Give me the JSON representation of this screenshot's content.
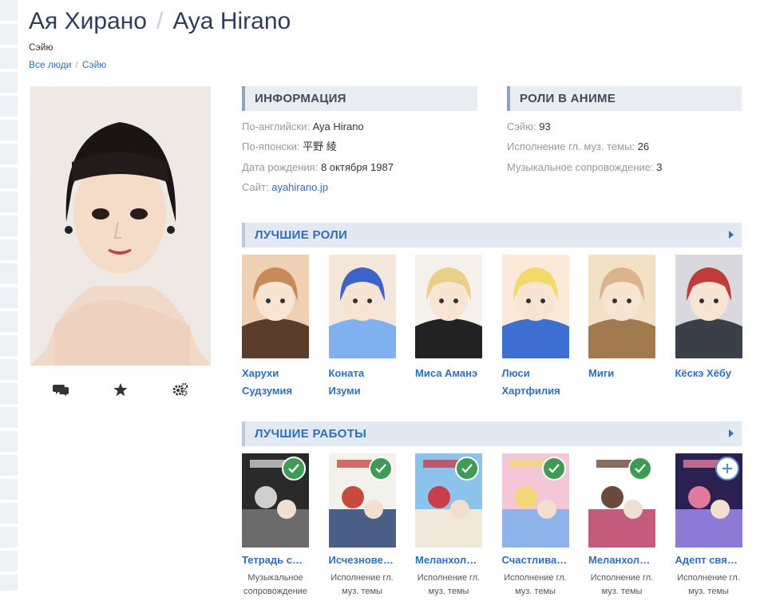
{
  "header": {
    "name_ru": "Ая Хирано",
    "separator": "/",
    "name_en": "Aya Hirano",
    "role": "Сэйю"
  },
  "breadcrumb": {
    "root": "Все люди",
    "sep": "/",
    "current": "Сэйю"
  },
  "actions": {
    "icons": [
      "comments-icon",
      "star-icon",
      "cogs-icon"
    ]
  },
  "info": {
    "title": "Информация",
    "rows": [
      {
        "label": "По-английски:",
        "value": "Aya Hirano"
      },
      {
        "label": "По-японски:",
        "value": "平野 綾"
      },
      {
        "label": "Дата рождения:",
        "value": "8 октября 1987"
      },
      {
        "label": "Сайт:",
        "value": "ayahirano.jp"
      }
    ]
  },
  "roles": {
    "title": "Роли в аниме",
    "rows": [
      {
        "label": "Сэйю:",
        "value": "93"
      },
      {
        "label": "Исполнение гл. муз. темы:",
        "value": "26"
      },
      {
        "label": "Музыкальное сопровождение:",
        "value": "3"
      }
    ]
  },
  "best_roles": {
    "title": "Лучшие роли",
    "items": [
      {
        "name": "Харухи Судзумия",
        "colors": [
          "#c98a5a",
          "#5a3d2b",
          "#f0d0b4"
        ]
      },
      {
        "name": "Коната Изуми",
        "colors": [
          "#3c64c8",
          "#7fb0f0",
          "#f5e6da"
        ]
      },
      {
        "name": "Миса Аманэ",
        "colors": [
          "#e8cf86",
          "#222222",
          "#f5f0ea"
        ]
      },
      {
        "name": "Люси Хартфилия",
        "colors": [
          "#f2d96a",
          "#3d6fd1",
          "#fbe9d7"
        ]
      },
      {
        "name": "Миги",
        "colors": [
          "#d9b48f",
          "#a27a4f",
          "#f3e1c6"
        ]
      },
      {
        "name": "Кёскэ Хёбу",
        "colors": [
          "#c23b3b",
          "#3a3f4a",
          "#d8d8de"
        ]
      }
    ]
  },
  "best_works": {
    "title": "Лучшие работы",
    "items": [
      {
        "name": "Тетрадь смерти",
        "role": "Музыкальное сопровождение",
        "status": "ok",
        "colors": [
          "#2a2a2a",
          "#6b6b6b",
          "#cfcfcf"
        ]
      },
      {
        "name": "Исчезновение Харухи Судзумии",
        "role": "Исполнение гл. муз. темы",
        "status": "ok",
        "colors": [
          "#f3f1ec",
          "#4b5e86",
          "#c94a3d"
        ]
      },
      {
        "name": "Меланхолия Харухи Судзумии",
        "role": "Исполнение гл. муз. темы",
        "status": "ok",
        "colors": [
          "#8cc3ea",
          "#f2e8d9",
          "#c63f4a"
        ]
      },
      {
        "name": "Счастливая звезда",
        "role": "Исполнение гл. муз. темы",
        "status": "ok",
        "colors": [
          "#f4c7d8",
          "#8db3ea",
          "#f1d77a"
        ]
      },
      {
        "name": "Меланхолия Харухи Судзумии",
        "role": "Исполнение гл. муз. темы",
        "status": "ok",
        "colors": [
          "#ffffff",
          "#c45a7c",
          "#6a4a3a"
        ]
      },
      {
        "name": "Адепт священного",
        "role": "Исполнение гл. муз. темы",
        "status": "add",
        "colors": [
          "#2a2150",
          "#8c7ad6",
          "#e27a9c"
        ]
      }
    ]
  }
}
